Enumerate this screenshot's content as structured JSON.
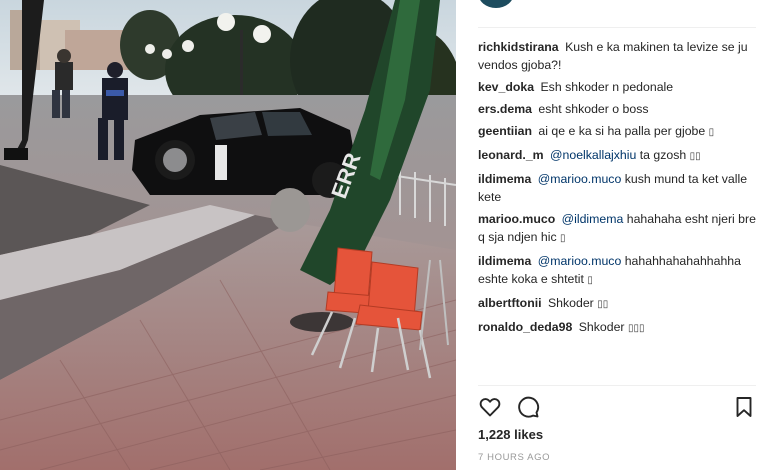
{
  "comments": [
    {
      "user": "richkidstirana",
      "text": " Kush e ka makinen ta levize se ju vendos gjoba?!"
    },
    {
      "user": "kev_doka",
      "text": " Esh shkoder n pedonale"
    },
    {
      "user": "ers.dema",
      "text": " esht shkoder o boss"
    },
    {
      "user": "geentiian",
      "text": " ai qe e ka si ha palla per gjobe ",
      "glyph": "▯"
    },
    {
      "user": "leonard._m",
      "mention": "@noelkallajxhiu",
      "text": " ta gzosh ",
      "glyph": "▯▯"
    },
    {
      "user": "ildimema",
      "mention": "@marioo.muco",
      "text": " kush mund ta ket valle kete"
    },
    {
      "user": "marioo.muco",
      "mention": "@ildimema",
      "text": " hahahaha esht njeri bre q sja ndjen hic ",
      "glyph": "▯"
    },
    {
      "user": "ildimema",
      "mention": "@marioo.muco",
      "text": " hahahhahahahhahha eshte koka e shtetit ",
      "glyph": "▯"
    },
    {
      "user": "albertftonii",
      "text": " Shkoder ",
      "glyph": "▯▯"
    },
    {
      "user": "ronaldo_deda98",
      "text": " Shkoder ",
      "glyph": "▯▯▯"
    }
  ],
  "likes": "1,228 likes",
  "time": "7 HOURS AGO",
  "icons": {
    "like": "heart-icon",
    "comment": "comment-bubble-icon",
    "save": "bookmark-icon"
  },
  "photo": {
    "umbrella_text": "ERR"
  }
}
